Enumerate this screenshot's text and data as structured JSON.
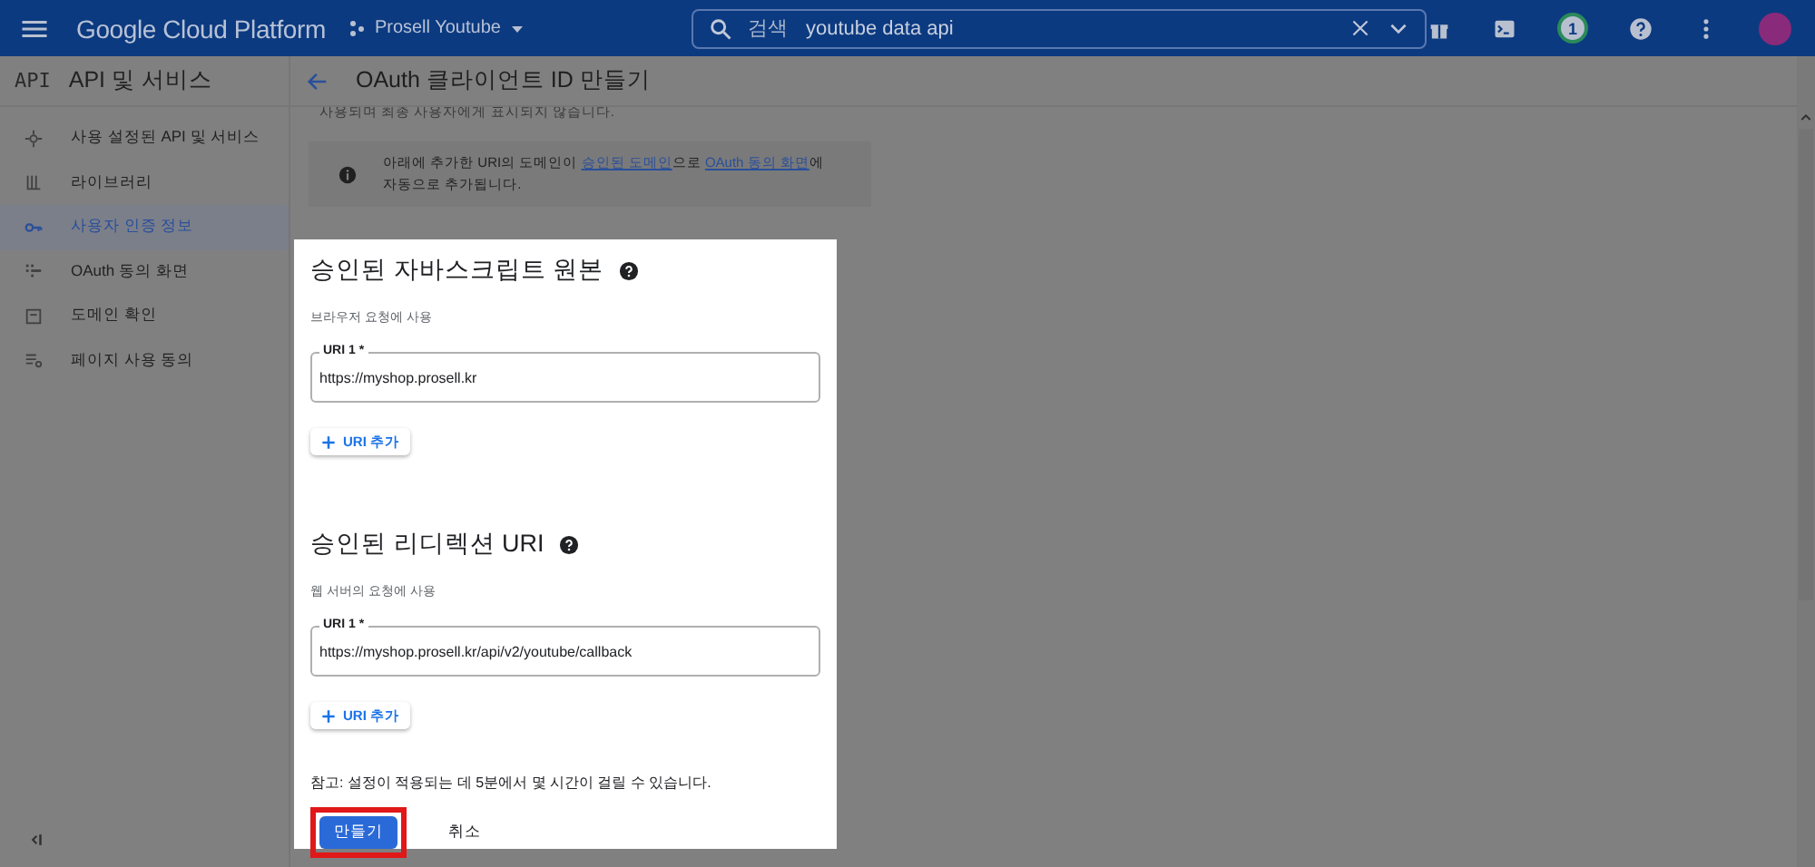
{
  "header": {
    "product": "Google Cloud Platform",
    "project": "Prosell Youtube",
    "search": {
      "label": "검색",
      "value": "youtube data api"
    },
    "notification_count": "1"
  },
  "sidebar": {
    "logo": "API",
    "title": "API 및 서비스",
    "items": [
      {
        "label": "사용 설정된 API 및 서비스",
        "selected": false
      },
      {
        "label": "라이브러리",
        "selected": false
      },
      {
        "label": "사용자 인증 정보",
        "selected": true
      },
      {
        "label": "OAuth 동의 화면",
        "selected": false
      },
      {
        "label": "도메인 확인",
        "selected": false
      },
      {
        "label": "페이지 사용 동의",
        "selected": false
      }
    ]
  },
  "page": {
    "title": "OAuth 클라이언트 ID 만들기",
    "cut_text": "사용되며 최종 사용자에게 표시되지 않습니다.",
    "info": [
      {
        "kind": "text",
        "text": "아래에 추가한 URI의 도메인이 "
      },
      {
        "kind": "link",
        "text": "승인된 도메인"
      },
      {
        "kind": "text",
        "text": "으로 "
      },
      {
        "kind": "link",
        "text": "OAuth 동의 화면"
      },
      {
        "kind": "text",
        "text": "에 자동으로 추가됩니다."
      }
    ]
  },
  "dialog": {
    "sections": [
      {
        "title": "승인된 자바스크립트 원본",
        "subtitle": "브라우저 요청에 사용",
        "field": {
          "label": "URI 1 *",
          "value": "https://myshop.prosell.kr"
        },
        "add_button": "URI 추가"
      },
      {
        "title": "승인된 리디렉션 URI",
        "subtitle": "웹 서버의 요청에 사용",
        "field": {
          "label": "URI 1 *",
          "value": "https://myshop.prosell.kr/api/v2/youtube/callback"
        },
        "add_button": "URI 추가"
      }
    ],
    "note": "참고: 설정이 적용되는 데 5분에서 몇 시간이 걸릴 수 있습니다.",
    "buttons": [
      {
        "label": "만들기",
        "kind": "primary",
        "highlighted": true
      },
      {
        "label": "취소",
        "kind": "text",
        "highlighted": false
      }
    ]
  }
}
